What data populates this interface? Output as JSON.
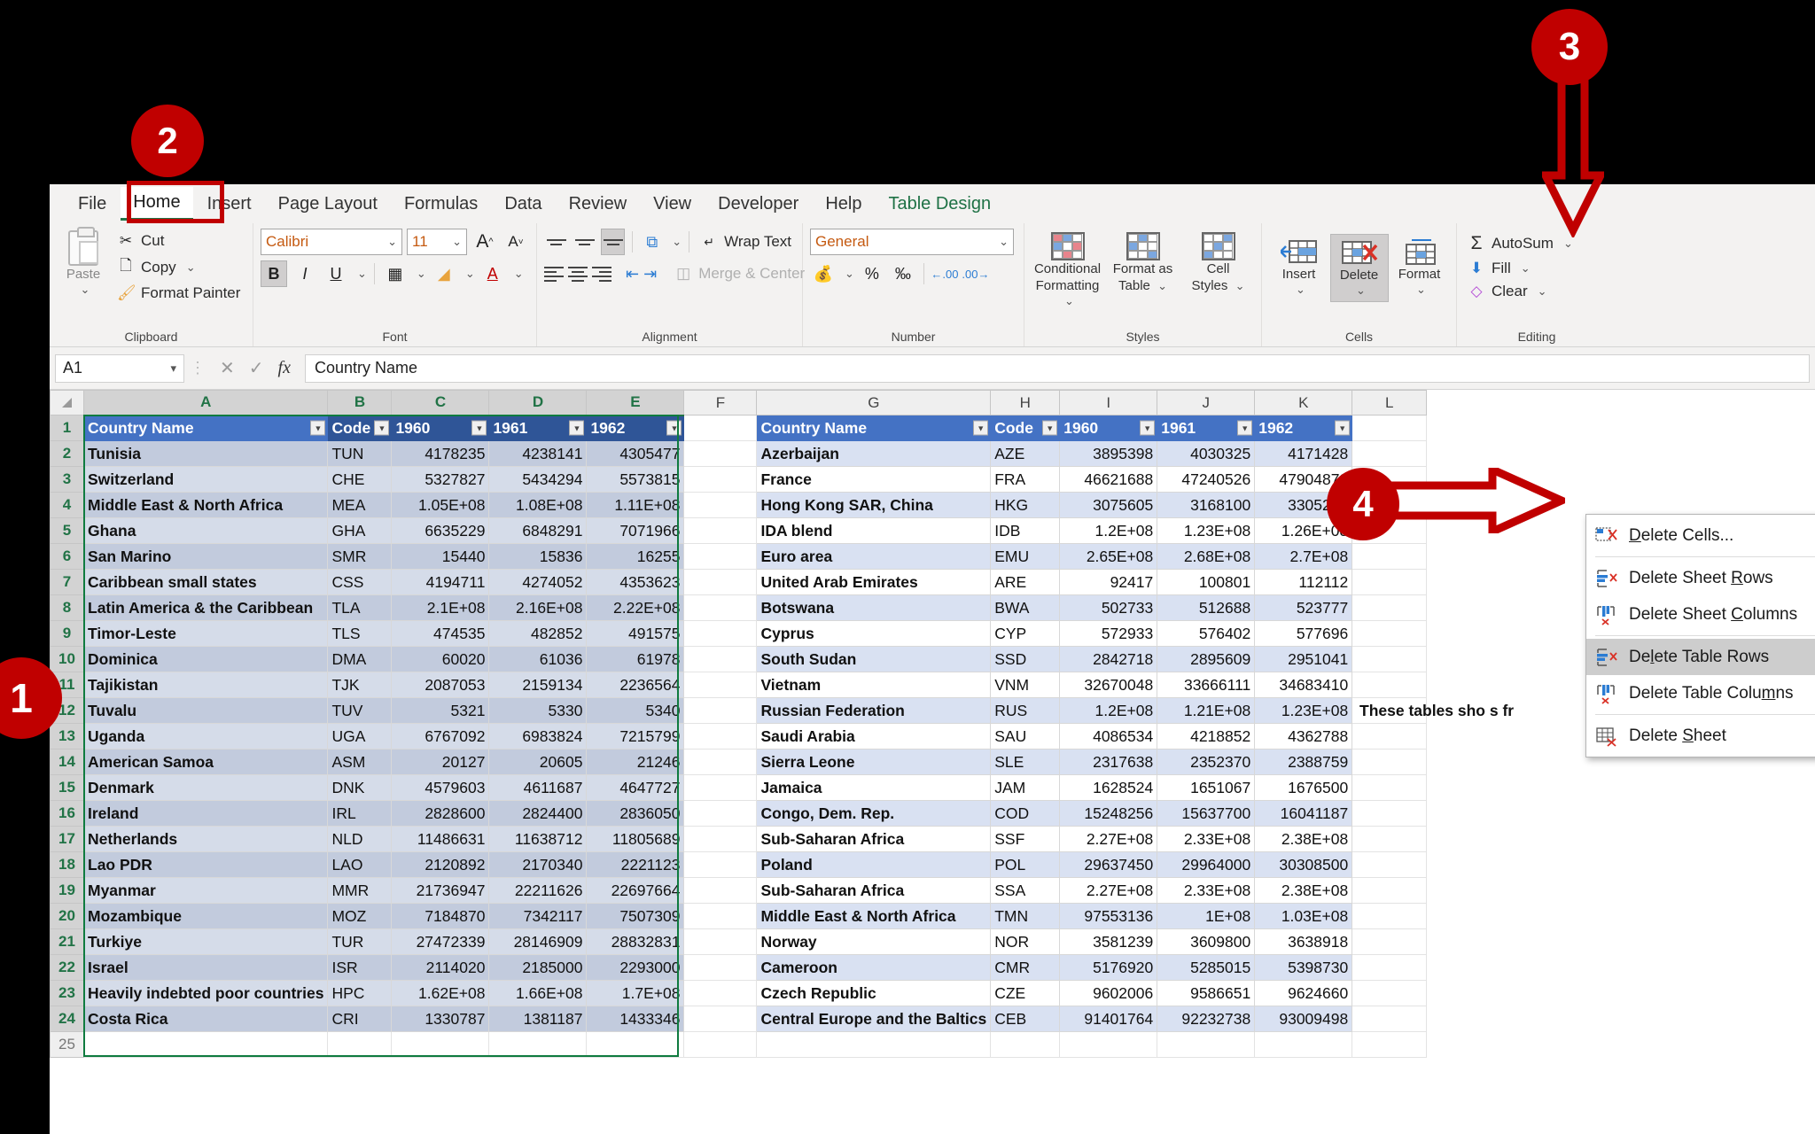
{
  "ribbon": {
    "tabs": [
      {
        "label": "File",
        "active": false,
        "contextual": false
      },
      {
        "label": "Home",
        "active": true,
        "contextual": false
      },
      {
        "label": "Insert",
        "active": false,
        "contextual": false
      },
      {
        "label": "Page Layout",
        "active": false,
        "contextual": false
      },
      {
        "label": "Formulas",
        "active": false,
        "contextual": false
      },
      {
        "label": "Data",
        "active": false,
        "contextual": false
      },
      {
        "label": "Review",
        "active": false,
        "contextual": false
      },
      {
        "label": "View",
        "active": false,
        "contextual": false
      },
      {
        "label": "Developer",
        "active": false,
        "contextual": false
      },
      {
        "label": "Help",
        "active": false,
        "contextual": false
      },
      {
        "label": "Table Design",
        "active": false,
        "contextual": true
      }
    ],
    "groups": {
      "clipboard": {
        "label": "Clipboard",
        "paste": "Paste",
        "cut": "Cut",
        "copy": "Copy",
        "format_painter": "Format Painter"
      },
      "font": {
        "label": "Font",
        "font_name": "Calibri",
        "font_size": "11",
        "grow": "A",
        "shrink": "A",
        "bold": "B",
        "italic": "I",
        "underline": "U"
      },
      "alignment": {
        "label": "Alignment",
        "wrap_text": "Wrap Text",
        "merge_center": "Merge & Center"
      },
      "number": {
        "label": "Number",
        "format": "General",
        "percent": "%",
        "comma": "‰"
      },
      "styles": {
        "label": "Styles",
        "conditional_formatting": "Conditional\nFormatting",
        "conditional_formatting_l1": "Conditional",
        "conditional_formatting_l2": "Formatting",
        "format_as_table_l1": "Format as",
        "format_as_table_l2": "Table",
        "cell_styles_l1": "Cell",
        "cell_styles_l2": "Styles"
      },
      "cells": {
        "label": "Cells",
        "insert": "Insert",
        "delete": "Delete",
        "format": "Format"
      },
      "editing": {
        "label": "Editing",
        "autosum": "AutoSum",
        "fill": "Fill",
        "clear": "Clear"
      }
    }
  },
  "formula_bar": {
    "name_box": "A1",
    "cancel_icon": "✕",
    "enter_icon": "✓",
    "fx": "fx",
    "value": "Country Name"
  },
  "grid": {
    "column_letters": [
      "A",
      "B",
      "C",
      "D",
      "E",
      "F",
      "G",
      "H",
      "I",
      "J",
      "K",
      "L"
    ],
    "selected_columns": [
      "A",
      "B",
      "C",
      "D",
      "E"
    ],
    "row_numbers": [
      "1",
      "2",
      "3",
      "4",
      "5",
      "6",
      "7",
      "8",
      "9",
      "10",
      "11",
      "12",
      "13",
      "14",
      "15",
      "16",
      "17",
      "18",
      "19",
      "20",
      "21",
      "22",
      "23",
      "24",
      "25"
    ],
    "note": "These tables sho                   s fr"
  },
  "table_left": {
    "headers": [
      "Country Name",
      "Code",
      "1960",
      "1961",
      "1962"
    ],
    "rows": [
      [
        "Tunisia",
        "TUN",
        "4178235",
        "4238141",
        "4305477"
      ],
      [
        "Switzerland",
        "CHE",
        "5327827",
        "5434294",
        "5573815"
      ],
      [
        "Middle East & North Africa",
        "MEA",
        "1.05E+08",
        "1.08E+08",
        "1.11E+08"
      ],
      [
        "Ghana",
        "GHA",
        "6635229",
        "6848291",
        "7071966"
      ],
      [
        "San Marino",
        "SMR",
        "15440",
        "15836",
        "16255"
      ],
      [
        "Caribbean small states",
        "CSS",
        "4194711",
        "4274052",
        "4353623"
      ],
      [
        "Latin America & the Caribbean",
        "TLA",
        "2.1E+08",
        "2.16E+08",
        "2.22E+08"
      ],
      [
        "Timor-Leste",
        "TLS",
        "474535",
        "482852",
        "491575"
      ],
      [
        "Dominica",
        "DMA",
        "60020",
        "61036",
        "61978"
      ],
      [
        "Tajikistan",
        "TJK",
        "2087053",
        "2159134",
        "2236564"
      ],
      [
        "Tuvalu",
        "TUV",
        "5321",
        "5330",
        "5340"
      ],
      [
        "Uganda",
        "UGA",
        "6767092",
        "6983824",
        "7215799"
      ],
      [
        "American Samoa",
        "ASM",
        "20127",
        "20605",
        "21246"
      ],
      [
        "Denmark",
        "DNK",
        "4579603",
        "4611687",
        "4647727"
      ],
      [
        "Ireland",
        "IRL",
        "2828600",
        "2824400",
        "2836050"
      ],
      [
        "Netherlands",
        "NLD",
        "11486631",
        "11638712",
        "11805689"
      ],
      [
        "Lao PDR",
        "LAO",
        "2120892",
        "2170340",
        "2221123"
      ],
      [
        "Myanmar",
        "MMR",
        "21736947",
        "22211626",
        "22697664"
      ],
      [
        "Mozambique",
        "MOZ",
        "7184870",
        "7342117",
        "7507309"
      ],
      [
        "Turkiye",
        "TUR",
        "27472339",
        "28146909",
        "28832831"
      ],
      [
        "Israel",
        "ISR",
        "2114020",
        "2185000",
        "2293000"
      ],
      [
        "Heavily indebted poor countries",
        "HPC",
        "1.62E+08",
        "1.66E+08",
        "1.7E+08"
      ],
      [
        "Costa Rica",
        "CRI",
        "1330787",
        "1381187",
        "1433346"
      ]
    ]
  },
  "table_right": {
    "headers": [
      "Country Name",
      "Code",
      "1960",
      "1961",
      "1962"
    ],
    "rows": [
      [
        "Azerbaijan",
        "AZE",
        "3895398",
        "4030325",
        "4171428"
      ],
      [
        "France",
        "FRA",
        "46621688",
        "47240526",
        "47904879"
      ],
      [
        "Hong Kong SAR, China",
        "HKG",
        "3075605",
        "3168100",
        "3305200"
      ],
      [
        "IDA blend",
        "IDB",
        "1.2E+08",
        "1.23E+08",
        "1.26E+08"
      ],
      [
        "Euro area",
        "EMU",
        "2.65E+08",
        "2.68E+08",
        "2.7E+08"
      ],
      [
        "United Arab Emirates",
        "ARE",
        "92417",
        "100801",
        "112112"
      ],
      [
        "Botswana",
        "BWA",
        "502733",
        "512688",
        "523777"
      ],
      [
        "Cyprus",
        "CYP",
        "572933",
        "576402",
        "577696"
      ],
      [
        "South Sudan",
        "SSD",
        "2842718",
        "2895609",
        "2951041"
      ],
      [
        "Vietnam",
        "VNM",
        "32670048",
        "33666111",
        "34683410"
      ],
      [
        "Russian Federation",
        "RUS",
        "1.2E+08",
        "1.21E+08",
        "1.23E+08"
      ],
      [
        "Saudi Arabia",
        "SAU",
        "4086534",
        "4218852",
        "4362788"
      ],
      [
        "Sierra Leone",
        "SLE",
        "2317638",
        "2352370",
        "2388759"
      ],
      [
        "Jamaica",
        "JAM",
        "1628524",
        "1651067",
        "1676500"
      ],
      [
        "Congo, Dem. Rep.",
        "COD",
        "15248256",
        "15637700",
        "16041187"
      ],
      [
        "Sub-Saharan Africa",
        "SSF",
        "2.27E+08",
        "2.33E+08",
        "2.38E+08"
      ],
      [
        "Poland",
        "POL",
        "29637450",
        "29964000",
        "30308500"
      ],
      [
        "Sub-Saharan Africa",
        "SSA",
        "2.27E+08",
        "2.33E+08",
        "2.38E+08"
      ],
      [
        "Middle East & North Africa",
        "TMN",
        "97553136",
        "1E+08",
        "1.03E+08"
      ],
      [
        "Norway",
        "NOR",
        "3581239",
        "3609800",
        "3638918"
      ],
      [
        "Cameroon",
        "CMR",
        "5176920",
        "5285015",
        "5398730"
      ],
      [
        "Czech Republic",
        "CZE",
        "9602006",
        "9586651",
        "9624660"
      ],
      [
        "Central Europe and the Baltics",
        "CEB",
        "91401764",
        "92232738",
        "93009498"
      ]
    ]
  },
  "delete_menu": {
    "items": [
      {
        "label": "Delete Cells...",
        "underline": "D",
        "icon": "delete-cells-icon",
        "highlighted": false,
        "separator_after": true
      },
      {
        "label": "Delete Sheet Rows",
        "underline": "R",
        "icon": "delete-sheet-rows-icon",
        "highlighted": false,
        "separator_after": false
      },
      {
        "label": "Delete Sheet Columns",
        "underline": "C",
        "icon": "delete-sheet-columns-icon",
        "highlighted": false,
        "separator_after": true
      },
      {
        "label": "Delete Table Rows",
        "underline": "l",
        "icon": "delete-table-rows-icon",
        "highlighted": true,
        "separator_after": false
      },
      {
        "label": "Delete Table Columns",
        "underline": "m",
        "icon": "delete-table-columns-icon",
        "highlighted": false,
        "separator_after": true
      },
      {
        "label": "Delete Sheet",
        "underline": "S",
        "icon": "delete-sheet-icon",
        "highlighted": false,
        "separator_after": false
      }
    ]
  },
  "annotations": {
    "badges": [
      {
        "number": "1"
      },
      {
        "number": "2"
      },
      {
        "number": "3"
      },
      {
        "number": "4"
      }
    ],
    "accent_color": "#C00000"
  }
}
